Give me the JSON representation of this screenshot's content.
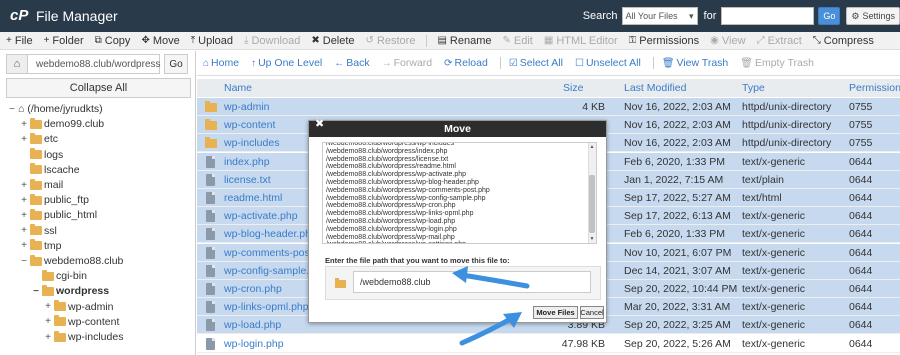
{
  "header": {
    "app_title": "File Manager",
    "search_label": "Search",
    "search_scope": "All Your Files",
    "for_label": "for",
    "search_value": "",
    "go_label": "Go",
    "settings_label": "Settings"
  },
  "toolbar": [
    {
      "icon": "+",
      "label": "File",
      "disabled": false
    },
    {
      "icon": "+",
      "label": "Folder",
      "disabled": false
    },
    {
      "icon": "⧉",
      "label": "Copy",
      "disabled": false
    },
    {
      "icon": "✥",
      "label": "Move",
      "disabled": false
    },
    {
      "icon": "⤒",
      "label": "Upload",
      "disabled": false
    },
    {
      "icon": "⤓",
      "label": "Download",
      "disabled": true
    },
    {
      "icon": "✖",
      "label": "Delete",
      "disabled": false
    },
    {
      "icon": "↺",
      "label": "Restore",
      "disabled": true
    },
    {
      "icon": "▤",
      "label": "Rename",
      "disabled": false
    },
    {
      "icon": "✎",
      "label": "Edit",
      "disabled": true
    },
    {
      "icon": "▦",
      "label": "HTML Editor",
      "disabled": true
    },
    {
      "icon": "⚿",
      "label": "Permissions",
      "disabled": false
    },
    {
      "icon": "◉",
      "label": "View",
      "disabled": true
    },
    {
      "icon": "⤢",
      "label": "Extract",
      "disabled": true
    },
    {
      "icon": "⤡",
      "label": "Compress",
      "disabled": false
    }
  ],
  "sidebar": {
    "path_value": "webdemo88.club/wordpress",
    "go_label": "Go",
    "collapse_label": "Collapse All",
    "tree": [
      {
        "toggle": "−",
        "label": "(/home/jyrudkts)",
        "home": true,
        "bold": false
      },
      {
        "toggle": "+",
        "label": "demo99.club",
        "home": false,
        "bold": false
      },
      {
        "toggle": "+",
        "label": "etc",
        "home": false,
        "bold": false
      },
      {
        "toggle": "",
        "label": "logs",
        "home": false,
        "bold": false
      },
      {
        "toggle": "",
        "label": "lscache",
        "home": false,
        "bold": false
      },
      {
        "toggle": "+",
        "label": "mail",
        "home": false,
        "bold": false
      },
      {
        "toggle": "+",
        "label": "public_ftp",
        "home": false,
        "bold": false
      },
      {
        "toggle": "+",
        "label": "public_html",
        "home": false,
        "bold": false
      },
      {
        "toggle": "+",
        "label": "ssl",
        "home": false,
        "bold": false
      },
      {
        "toggle": "+",
        "label": "tmp",
        "home": false,
        "bold": false
      },
      {
        "toggle": "−",
        "label": "webdemo88.club",
        "home": false,
        "bold": false
      },
      {
        "toggle": "",
        "label": "cgi-bin",
        "home": false,
        "bold": false
      },
      {
        "toggle": "−",
        "label": "wordpress",
        "home": false,
        "bold": true
      },
      {
        "toggle": "+",
        "label": "wp-admin",
        "home": false,
        "bold": false
      },
      {
        "toggle": "+",
        "label": "wp-content",
        "home": false,
        "bold": false
      },
      {
        "toggle": "+",
        "label": "wp-includes",
        "home": false,
        "bold": false
      }
    ]
  },
  "navbar": [
    {
      "icon": "⌂",
      "label": "Home",
      "disabled": false
    },
    {
      "icon": "↑",
      "label": "Up One Level",
      "disabled": false
    },
    {
      "icon": "←",
      "label": "Back",
      "disabled": false
    },
    {
      "icon": "→",
      "label": "Forward",
      "disabled": true
    },
    {
      "icon": "⟳",
      "label": "Reload",
      "disabled": false
    },
    {
      "icon": "☑",
      "label": "Select All",
      "disabled": false
    },
    {
      "icon": "☐",
      "label": "Unselect All",
      "disabled": false
    },
    {
      "icon": "🗑",
      "label": "View Trash",
      "disabled": false
    },
    {
      "icon": "🗑",
      "label": "Empty Trash",
      "disabled": true
    }
  ],
  "table": {
    "columns": [
      "Name",
      "Size",
      "Last Modified",
      "Type",
      "Permissions"
    ],
    "rows": [
      {
        "kind": "folder",
        "name": "wp-admin",
        "size": "4 KB",
        "modified": "Nov 16, 2022, 2:03 AM",
        "type": "httpd/unix-directory",
        "perms": "0755"
      },
      {
        "kind": "folder",
        "name": "wp-content",
        "size": "",
        "modified": "Nov 16, 2022, 2:03 AM",
        "type": "httpd/unix-directory",
        "perms": "0755"
      },
      {
        "kind": "folder",
        "name": "wp-includes",
        "size": "",
        "modified": "Nov 16, 2022, 2:03 AM",
        "type": "httpd/unix-directory",
        "perms": "0755"
      },
      {
        "kind": "file",
        "name": "index.php",
        "size": "",
        "modified": "Feb 6, 2020, 1:33 PM",
        "type": "text/x-generic",
        "perms": "0644"
      },
      {
        "kind": "file",
        "name": "license.txt",
        "size": "",
        "modified": "Jan 1, 2022, 7:15 AM",
        "type": "text/plain",
        "perms": "0644"
      },
      {
        "kind": "file",
        "name": "readme.html",
        "size": "",
        "modified": "Sep 17, 2022, 5:27 AM",
        "type": "text/html",
        "perms": "0644"
      },
      {
        "kind": "file",
        "name": "wp-activate.php",
        "size": "",
        "modified": "Sep 17, 2022, 6:13 AM",
        "type": "text/x-generic",
        "perms": "0644"
      },
      {
        "kind": "file",
        "name": "wp-blog-header.php",
        "size": "",
        "modified": "Feb 6, 2020, 1:33 PM",
        "type": "text/x-generic",
        "perms": "0644"
      },
      {
        "kind": "file",
        "name": "wp-comments-post.php",
        "size": "",
        "modified": "Nov 10, 2021, 6:07 PM",
        "type": "text/x-generic",
        "perms": "0644"
      },
      {
        "kind": "file",
        "name": "wp-config-sample.php",
        "size": "",
        "modified": "Dec 14, 2021, 3:07 AM",
        "type": "text/x-generic",
        "perms": "0644"
      },
      {
        "kind": "file",
        "name": "wp-cron.php",
        "size": "",
        "modified": "Sep 20, 2022, 10:44 PM",
        "type": "text/x-generic",
        "perms": "0644"
      },
      {
        "kind": "file",
        "name": "wp-links-opml.php",
        "size": "",
        "modified": "Mar 20, 2022, 3:31 AM",
        "type": "text/x-generic",
        "perms": "0644"
      },
      {
        "kind": "file",
        "name": "wp-load.php",
        "size": "3.89 KB",
        "modified": "Sep 20, 2022, 3:25 AM",
        "type": "text/x-generic",
        "perms": "0644"
      },
      {
        "kind": "file",
        "name": "wp-login.php",
        "size": "47.98 KB",
        "modified": "Sep 20, 2022, 5:26 AM",
        "type": "text/x-generic",
        "perms": "0644"
      }
    ]
  },
  "modal": {
    "title": "Move",
    "close_icon": "✖",
    "files": [
      "/webdemo88.club/wordpress/wp-includes",
      "/webdemo88.club/wordpress/index.php",
      "/webdemo88.club/wordpress/license.txt",
      "/webdemo88.club/wordpress/readme.html",
      "/webdemo88.club/wordpress/wp-activate.php",
      "/webdemo88.club/wordpress/wp-blog-header.php",
      "/webdemo88.club/wordpress/wp-comments-post.php",
      "/webdemo88.club/wordpress/wp-config-sample.php",
      "/webdemo88.club/wordpress/wp-cron.php",
      "/webdemo88.club/wordpress/wp-links-opml.php",
      "/webdemo88.club/wordpress/wp-load.php",
      "/webdemo88.club/wordpress/wp-login.php",
      "/webdemo88.club/wordpress/wp-mail.php",
      "/webdemo88.club/wordpress/wp-settings.php"
    ],
    "dest_label": "Enter the file path that you want to move this file to:",
    "dest_value": "/webdemo88.club",
    "move_label": "Move Files",
    "cancel_label": "Cancel"
  },
  "colors": {
    "header_bg": "#293a4a",
    "accent": "#3a7bc8",
    "folder": "#e8b252",
    "selected_row": "#c6d9ef",
    "annotation_arrow": "#3d8fe0"
  }
}
